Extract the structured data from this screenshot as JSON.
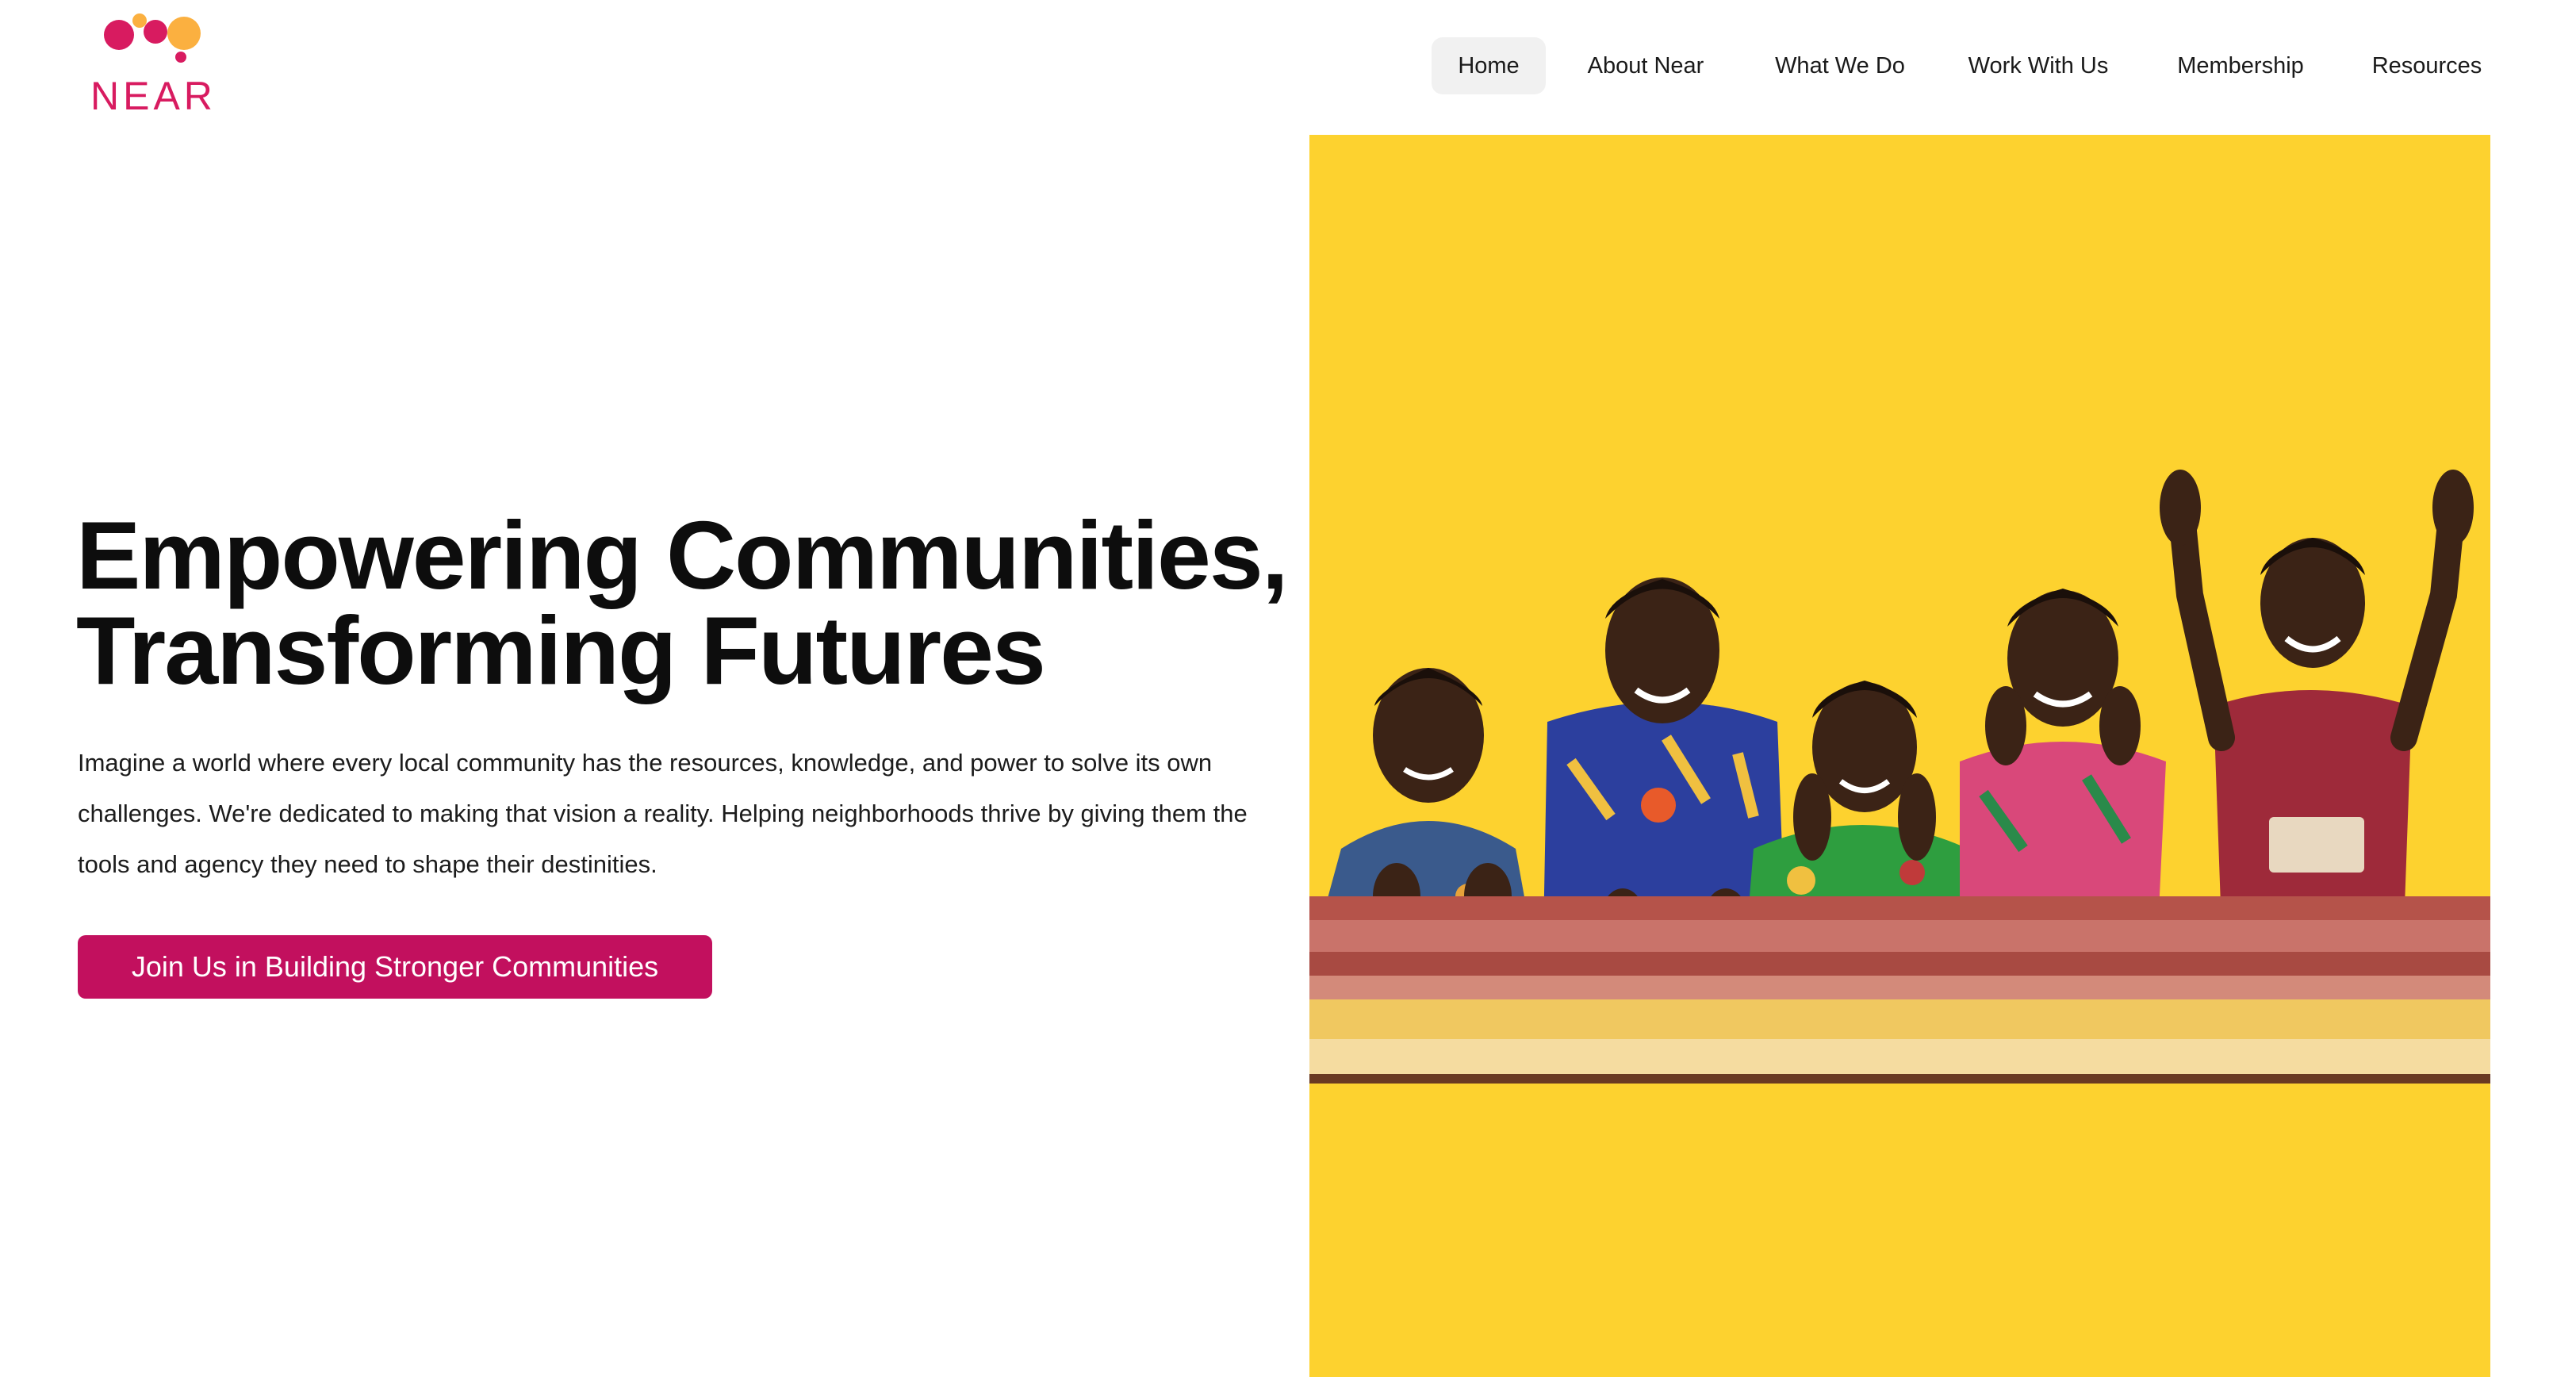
{
  "brand": {
    "name": "NEAR",
    "colors": {
      "primary": "#c2105e",
      "accent": "#fbb040",
      "panel": "#fdd22f"
    }
  },
  "nav": {
    "items": [
      {
        "label": "Home",
        "active": true
      },
      {
        "label": "About Near",
        "active": false
      },
      {
        "label": "What We Do",
        "active": false
      },
      {
        "label": "Work With Us",
        "active": false
      },
      {
        "label": "Membership",
        "active": false
      },
      {
        "label": "Resources",
        "active": false
      }
    ]
  },
  "hero": {
    "title_line1": "Empowering Communities,",
    "title_line2": "Transforming Futures",
    "body": "Imagine a world where every local community has the resources, knowledge, and power to solve its own challenges. We're dedicated to making that vision a reality. Helping neighborhoods thrive by giving them the tools and agency they need to shape their destinities.",
    "cta_label": "Join Us in Building Stronger Communities"
  }
}
